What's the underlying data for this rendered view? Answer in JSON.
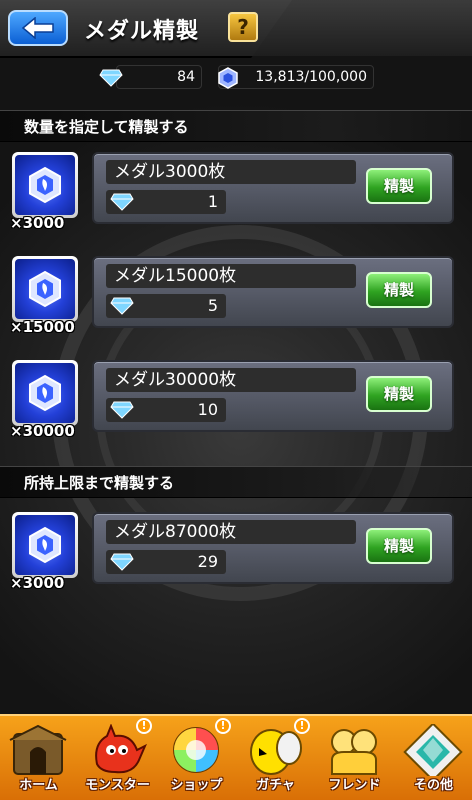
{
  "header": {
    "title": "メダル精製",
    "help_label": "?"
  },
  "currency": {
    "gems": "84",
    "medals": "13,813/100,000"
  },
  "sections": [
    {
      "title": "数量を指定して精製する"
    },
    {
      "title": "所持上限まで精製する"
    }
  ],
  "rows": [
    {
      "qty_label": "×3000",
      "name": "メダル3000枚",
      "cost": "1",
      "button": "精製"
    },
    {
      "qty_label": "×15000",
      "name": "メダル15000枚",
      "cost": "5",
      "button": "精製"
    },
    {
      "qty_label": "×30000",
      "name": "メダル30000枚",
      "cost": "10",
      "button": "精製"
    },
    {
      "qty_label": "×3000",
      "name": "メダル87000枚",
      "cost": "29",
      "button": "精製"
    }
  ],
  "nav": [
    {
      "label": "ホーム",
      "icon": "home-icon"
    },
    {
      "label": "モンスター",
      "icon": "monster-icon"
    },
    {
      "label": "ショップ",
      "icon": "shop-icon"
    },
    {
      "label": "ガチャ",
      "icon": "gacha-icon"
    },
    {
      "label": "フレンド",
      "icon": "friend-icon"
    },
    {
      "label": "その他",
      "icon": "other-icon"
    }
  ],
  "badge_label": "!",
  "colors": {
    "accent_blue": "#2b73e6",
    "button_green": "#2fa321",
    "nav_orange": "#f08a0e"
  }
}
